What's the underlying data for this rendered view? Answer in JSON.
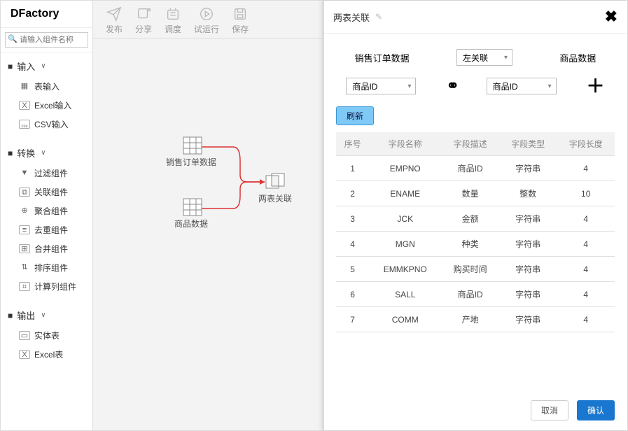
{
  "brand": "DFactory",
  "search": {
    "placeholder": "请输入组件名称"
  },
  "tree": {
    "group_input": "输入",
    "group_transform": "转换",
    "group_output": "输出",
    "input_table": "表输入",
    "input_excel": "Excel输入",
    "input_csv": "CSV输入",
    "t_filter": "过滤组件",
    "t_join": "关联组件",
    "t_agg": "聚合组件",
    "t_dedup": "去重组件",
    "t_union": "合并组件",
    "t_sort": "排序组件",
    "t_calc": "计算列组件",
    "out_entity": "实体表",
    "out_excel": "Excel表"
  },
  "toolbar": {
    "publish": "发布",
    "share": "分享",
    "schedule": "调度",
    "test_run": "试运行",
    "save": "保存"
  },
  "canvas": {
    "sales_data": "销售订单数据",
    "product_data": "商品数据",
    "join_node": "两表关联"
  },
  "panel": {
    "title": "两表关联",
    "sales_label": "销售订单数据",
    "join_type": "左关联",
    "product_label": "商品数据",
    "field_left": "商品ID",
    "field_right": "商品ID",
    "refresh": "刷新",
    "th": {
      "seq": "序号",
      "name": "字段名称",
      "desc": "字段描述",
      "type": "字段类型",
      "len": "字段长度"
    },
    "rows": [
      {
        "seq": "1",
        "name": "EMPNO",
        "desc": "商品ID",
        "type": "字符串",
        "len": "4"
      },
      {
        "seq": "2",
        "name": "ENAME",
        "desc": "数量",
        "type": "整数",
        "len": "10"
      },
      {
        "seq": "3",
        "name": "JCK",
        "desc": "金额",
        "type": "字符串",
        "len": "4"
      },
      {
        "seq": "4",
        "name": "MGN",
        "desc": "种类",
        "type": "字符串",
        "len": "4"
      },
      {
        "seq": "5",
        "name": "EMMKPNO",
        "desc": "购买时间",
        "type": "字符串",
        "len": "4"
      },
      {
        "seq": "6",
        "name": "SALL",
        "desc": "商品ID",
        "type": "字符串",
        "len": "4"
      },
      {
        "seq": "7",
        "name": "COMM",
        "desc": "产地",
        "type": "字符串",
        "len": "4"
      }
    ],
    "cancel": "取消",
    "ok": "确认"
  }
}
